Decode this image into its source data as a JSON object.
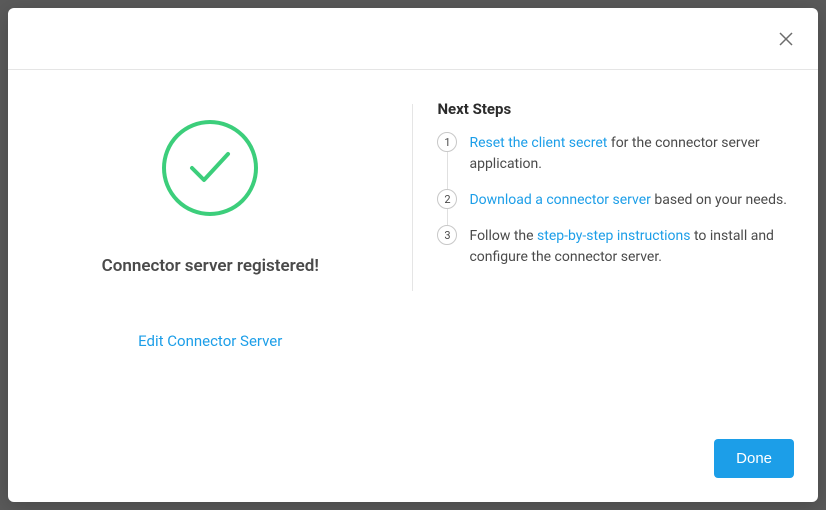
{
  "left": {
    "success_message": "Connector server registered!",
    "edit_link_label": "Edit Connector Server"
  },
  "right": {
    "heading": "Next Steps",
    "steps": [
      {
        "num": "1",
        "link": "Reset the client secret",
        "suffix": " for the connector server application."
      },
      {
        "num": "2",
        "link": "Download a connector server",
        "suffix": " based on your needs."
      },
      {
        "num": "3",
        "prefix": "Follow the ",
        "link": "step-by-step instructions",
        "suffix": " to install and configure the connector server."
      }
    ]
  },
  "footer": {
    "done_label": "Done"
  }
}
